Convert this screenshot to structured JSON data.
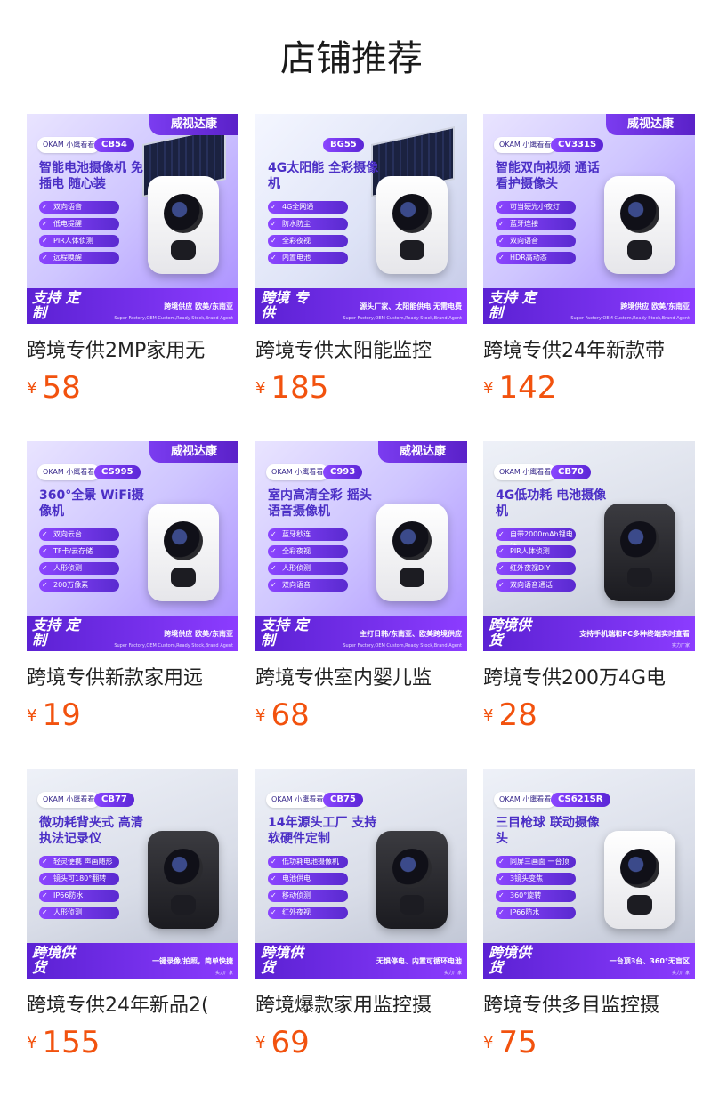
{
  "page": {
    "title": "店铺推荐"
  },
  "currency_symbol": "¥",
  "products": [
    {
      "name": "跨境专供2MP家用无",
      "price": "58",
      "thumb": {
        "ribbon": "威视达康",
        "brand": "OKAM 小鹰看看",
        "model": "CB54",
        "headline": "智能电池摄像机 免插电 随心装",
        "features": [
          "双向语音",
          "低电提醒",
          "PIR人体侦测",
          "远程唤醒"
        ],
        "bottom_tag": "支持 定制",
        "bottom_text": "跨境供应 欧美/东南亚",
        "bottom_sub": "Super Factory,OEM Custom,Ready Stock,Brand Agent",
        "cam": "white",
        "solar": true,
        "style": ""
      }
    },
    {
      "name": "跨境专供太阳能监控",
      "price": "185",
      "thumb": {
        "ribbon": "",
        "brand": "",
        "model": "BG55",
        "headline": "4G太阳能 全彩摄像机",
        "features": [
          "4G全网通",
          "防水防尘",
          "全彩夜视",
          "内置电池"
        ],
        "bottom_tag": "跨境 专供",
        "bottom_text": "源头厂家、太阳能供电 无需电费",
        "bottom_sub": "Super Factory,OEM Custom,Ready Stock,Brand Agent",
        "cam": "white",
        "solar": true,
        "style": "alt1"
      }
    },
    {
      "name": "跨境专供24年新款带",
      "price": "142",
      "thumb": {
        "ribbon": "威视达康",
        "brand": "OKAM 小鹰看看",
        "model": "CV331S",
        "headline": "智能双向视频 通话看护摄像头",
        "features": [
          "可当硬光小夜灯",
          "蓝牙连接",
          "双向语音",
          "HDR高动态"
        ],
        "bottom_tag": "支持 定制",
        "bottom_text": "跨境供应 欧美/东南亚",
        "bottom_sub": "Super Factory,OEM Custom,Ready Stock,Brand Agent",
        "cam": "white",
        "solar": false,
        "style": ""
      }
    },
    {
      "name": "跨境专供新款家用远",
      "price": "19",
      "thumb": {
        "ribbon": "威视达康",
        "brand": "OKAM 小鹰看看",
        "model": "CS995",
        "headline": "360°全景 WiFi摄像机",
        "features": [
          "双向云台",
          "TF卡/云存储",
          "人形侦测",
          "200万像素"
        ],
        "bottom_tag": "支持 定制",
        "bottom_text": "跨境供应 欧美/东南亚",
        "bottom_sub": "Super Factory,OEM Custom,Ready Stock,Brand Agent",
        "cam": "white",
        "solar": false,
        "style": ""
      }
    },
    {
      "name": "跨境专供室内婴儿监",
      "price": "68",
      "thumb": {
        "ribbon": "威视达康",
        "brand": "OKAM 小鹰看看",
        "model": "C993",
        "headline": "室内高清全彩 摇头语音摄像机",
        "features": [
          "蓝牙秒连",
          "全彩夜视",
          "人形侦测",
          "双向语音"
        ],
        "bottom_tag": "支持 定制",
        "bottom_text": "主打日韩/东南亚、欧美跨境供应",
        "bottom_sub": "Super Factory,OEM Custom,Ready Stock,Brand Agent",
        "cam": "white",
        "solar": false,
        "style": ""
      }
    },
    {
      "name": "跨境专供200万4G电",
      "price": "28",
      "thumb": {
        "ribbon": "",
        "brand": "OKAM 小鹰看看",
        "model": "CB70",
        "headline": "4G低功耗 电池摄像机",
        "features": [
          "自带2000mAh锂电池",
          "PIR人体侦测",
          "红外夜视DIY",
          "双向语音通话"
        ],
        "bottom_tag": "跨境供货",
        "bottom_text": "支持手机端和PC多种终端实时查看",
        "bottom_sub": "实力厂家",
        "cam": "dark",
        "solar": false,
        "style": "alt2"
      }
    },
    {
      "name": "跨境专供24年新品2(",
      "price": "155",
      "thumb": {
        "ribbon": "",
        "brand": "OKAM 小鹰看看",
        "model": "CB77",
        "headline": "微功耗背夹式 高清执法记录仪",
        "features": [
          "轻灵便携 声画随形",
          "镜头可180°翻转",
          "IP66防水",
          "人形侦测"
        ],
        "bottom_tag": "跨境供货",
        "bottom_text": "一键录像/拍照，简单快捷",
        "bottom_sub": "实力厂家",
        "cam": "dark",
        "solar": false,
        "style": "alt2"
      }
    },
    {
      "name": "跨境爆款家用监控摄",
      "price": "69",
      "thumb": {
        "ribbon": "",
        "brand": "OKAM 小鹰看看",
        "model": "CB75",
        "headline": "14年源头工厂 支持软硬件定制",
        "features": [
          "低功耗电池摄像机",
          "电池供电",
          "移动侦测",
          "红外夜视"
        ],
        "bottom_tag": "跨境供货",
        "bottom_text": "无惧停电、内置可循环电池",
        "bottom_sub": "实力厂家",
        "cam": "dark",
        "solar": false,
        "style": "alt2"
      }
    },
    {
      "name": "跨境专供多目监控摄",
      "price": "75",
      "thumb": {
        "ribbon": "",
        "brand": "OKAM 小鹰看看",
        "model": "CS621SR",
        "headline": "三目枪球 联动摄像头",
        "features": [
          "同屏三画面 一台顶三台",
          "3镜头变焦",
          "360°旋转",
          "IP66防水"
        ],
        "bottom_tag": "跨境供货",
        "bottom_text": "一台顶3台、360°无盲区",
        "bottom_sub": "实力厂家",
        "cam": "white",
        "solar": false,
        "style": "alt2"
      }
    }
  ]
}
